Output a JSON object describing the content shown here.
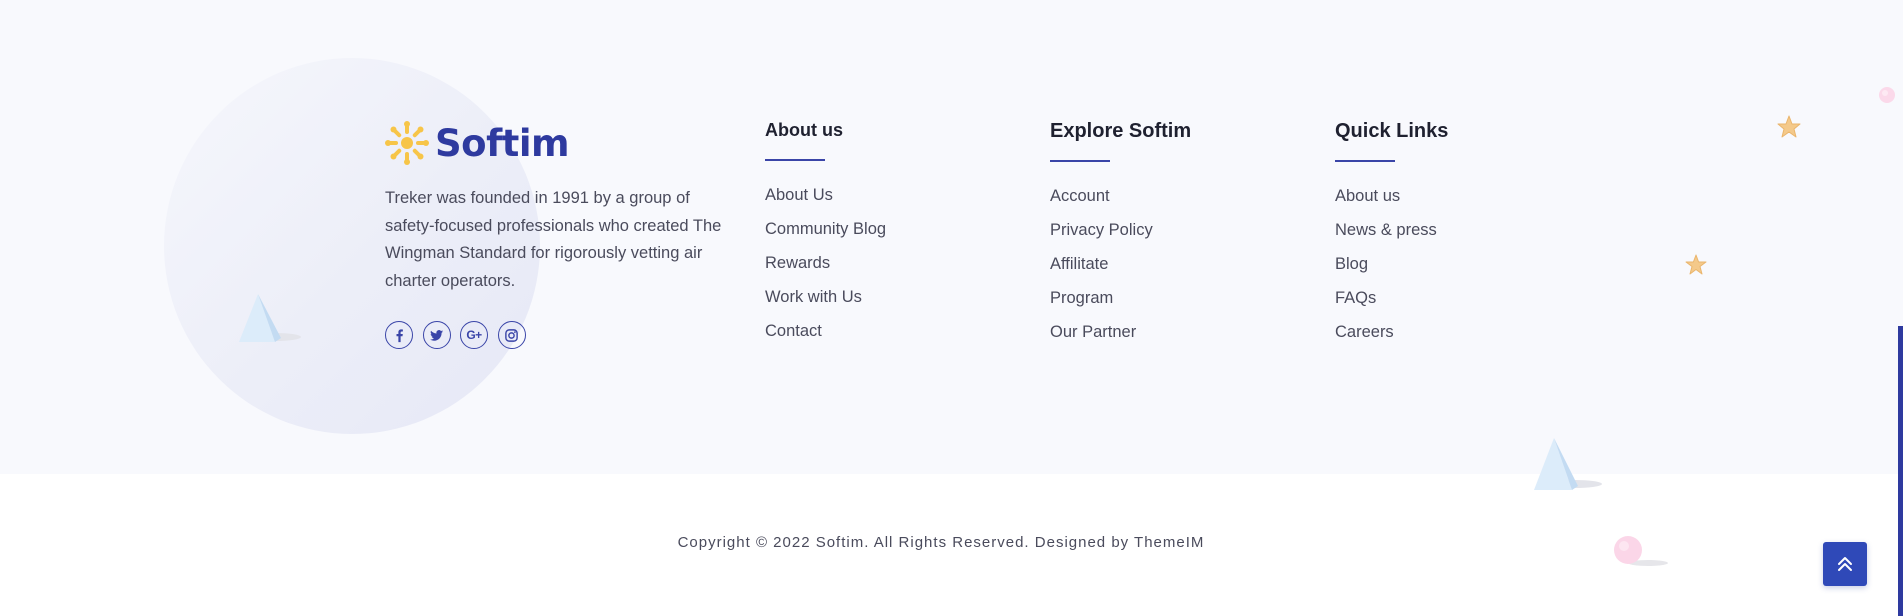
{
  "brand": {
    "name": "Softim",
    "description": "Treker was founded in 1991 by a group of safety-focused professionals who created The Wingman Standard for rigorously vetting air charter operators.",
    "social_icons": [
      "facebook-icon",
      "twitter-icon",
      "google-plus-icon",
      "instagram-icon"
    ],
    "google_plus_glyph": "G+"
  },
  "columns": {
    "about": {
      "title": "About us",
      "links": [
        "About Us",
        "Community Blog",
        "Rewards",
        "Work with Us",
        "Contact"
      ]
    },
    "explore": {
      "title": "Explore Softim",
      "links": [
        "Account",
        "Privacy Policy",
        "Affilitate",
        "Program",
        "Our Partner"
      ]
    },
    "quick": {
      "title": "Quick Links",
      "links": [
        "About us",
        "News & press",
        "Blog",
        "FAQs",
        "Careers"
      ]
    }
  },
  "copyright": "Copyright © 2022 Softim. All Rights Reserved. Designed by ThemeIM",
  "scroll_top_icon": "double-chevron-up-icon",
  "colors": {
    "brand": "#2e3a9f",
    "accent_yellow": "#f7c548",
    "button": "#2f49b8",
    "footer_bg": "#f8f9fd"
  }
}
